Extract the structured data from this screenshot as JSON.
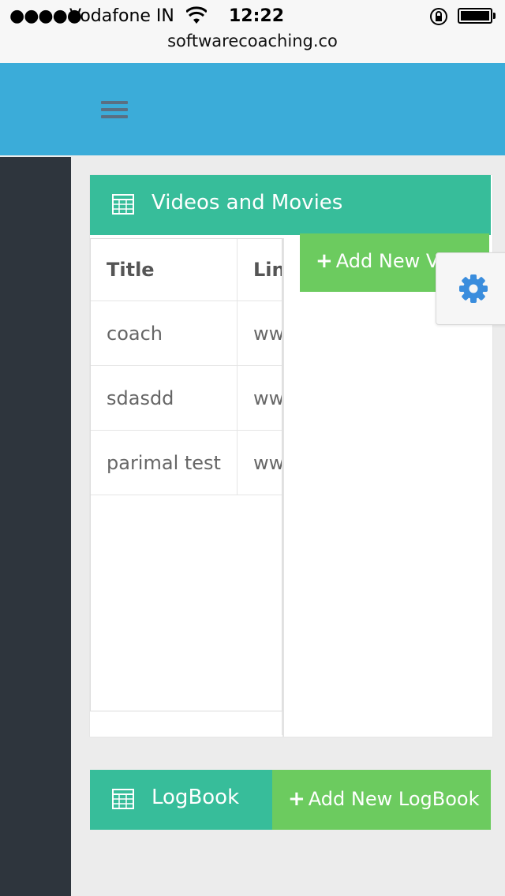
{
  "status_bar": {
    "signal": "●●●●●",
    "carrier": "Vodafone IN",
    "time": "12:22",
    "url": "softwarecoaching.co"
  },
  "topbar": {
    "menu_icon": "hamburger-icon",
    "color": "#3bacd9"
  },
  "videos_panel": {
    "title": "Videos and Movies",
    "icon": "table-icon",
    "add_button": "Add New Video",
    "table": {
      "headers": [
        "Title",
        "Link"
      ],
      "rows": [
        [
          "coach",
          "www"
        ],
        [
          "sdasdd",
          "www"
        ],
        [
          "parimal test",
          "www"
        ]
      ]
    }
  },
  "settings": {
    "icon": "gear-icon"
  },
  "logbook_panel": {
    "title": "LogBook",
    "icon": "table-icon",
    "add_button": "Add New LogBook"
  },
  "colors": {
    "header_teal": "#37bd9a",
    "button_green": "#6ccb5f",
    "sidebar": "#2e353d",
    "gear_blue": "#3a8ddd"
  }
}
